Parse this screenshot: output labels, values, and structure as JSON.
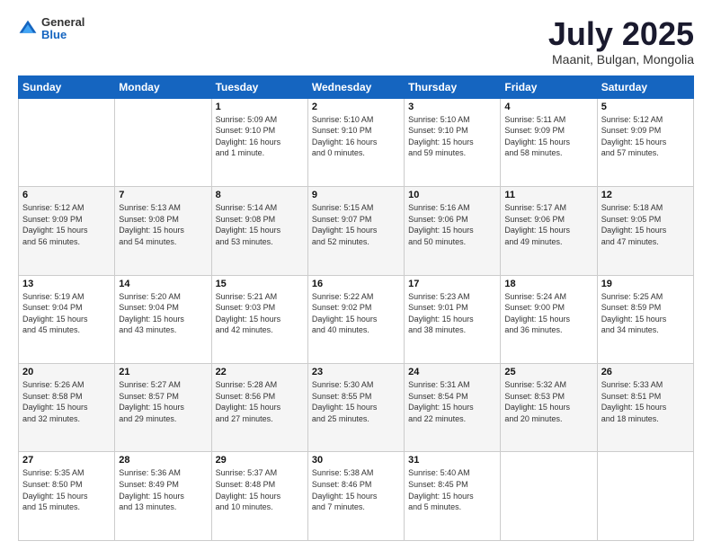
{
  "header": {
    "logo": {
      "general": "General",
      "blue": "Blue"
    },
    "title": "July 2025",
    "location": "Maanit, Bulgan, Mongolia"
  },
  "days_header": [
    "Sunday",
    "Monday",
    "Tuesday",
    "Wednesday",
    "Thursday",
    "Friday",
    "Saturday"
  ],
  "weeks": [
    [
      {
        "day": "",
        "content": ""
      },
      {
        "day": "",
        "content": ""
      },
      {
        "day": "1",
        "content": "Sunrise: 5:09 AM\nSunset: 9:10 PM\nDaylight: 16 hours\nand 1 minute."
      },
      {
        "day": "2",
        "content": "Sunrise: 5:10 AM\nSunset: 9:10 PM\nDaylight: 16 hours\nand 0 minutes."
      },
      {
        "day": "3",
        "content": "Sunrise: 5:10 AM\nSunset: 9:10 PM\nDaylight: 15 hours\nand 59 minutes."
      },
      {
        "day": "4",
        "content": "Sunrise: 5:11 AM\nSunset: 9:09 PM\nDaylight: 15 hours\nand 58 minutes."
      },
      {
        "day": "5",
        "content": "Sunrise: 5:12 AM\nSunset: 9:09 PM\nDaylight: 15 hours\nand 57 minutes."
      }
    ],
    [
      {
        "day": "6",
        "content": "Sunrise: 5:12 AM\nSunset: 9:09 PM\nDaylight: 15 hours\nand 56 minutes."
      },
      {
        "day": "7",
        "content": "Sunrise: 5:13 AM\nSunset: 9:08 PM\nDaylight: 15 hours\nand 54 minutes."
      },
      {
        "day": "8",
        "content": "Sunrise: 5:14 AM\nSunset: 9:08 PM\nDaylight: 15 hours\nand 53 minutes."
      },
      {
        "day": "9",
        "content": "Sunrise: 5:15 AM\nSunset: 9:07 PM\nDaylight: 15 hours\nand 52 minutes."
      },
      {
        "day": "10",
        "content": "Sunrise: 5:16 AM\nSunset: 9:06 PM\nDaylight: 15 hours\nand 50 minutes."
      },
      {
        "day": "11",
        "content": "Sunrise: 5:17 AM\nSunset: 9:06 PM\nDaylight: 15 hours\nand 49 minutes."
      },
      {
        "day": "12",
        "content": "Sunrise: 5:18 AM\nSunset: 9:05 PM\nDaylight: 15 hours\nand 47 minutes."
      }
    ],
    [
      {
        "day": "13",
        "content": "Sunrise: 5:19 AM\nSunset: 9:04 PM\nDaylight: 15 hours\nand 45 minutes."
      },
      {
        "day": "14",
        "content": "Sunrise: 5:20 AM\nSunset: 9:04 PM\nDaylight: 15 hours\nand 43 minutes."
      },
      {
        "day": "15",
        "content": "Sunrise: 5:21 AM\nSunset: 9:03 PM\nDaylight: 15 hours\nand 42 minutes."
      },
      {
        "day": "16",
        "content": "Sunrise: 5:22 AM\nSunset: 9:02 PM\nDaylight: 15 hours\nand 40 minutes."
      },
      {
        "day": "17",
        "content": "Sunrise: 5:23 AM\nSunset: 9:01 PM\nDaylight: 15 hours\nand 38 minutes."
      },
      {
        "day": "18",
        "content": "Sunrise: 5:24 AM\nSunset: 9:00 PM\nDaylight: 15 hours\nand 36 minutes."
      },
      {
        "day": "19",
        "content": "Sunrise: 5:25 AM\nSunset: 8:59 PM\nDaylight: 15 hours\nand 34 minutes."
      }
    ],
    [
      {
        "day": "20",
        "content": "Sunrise: 5:26 AM\nSunset: 8:58 PM\nDaylight: 15 hours\nand 32 minutes."
      },
      {
        "day": "21",
        "content": "Sunrise: 5:27 AM\nSunset: 8:57 PM\nDaylight: 15 hours\nand 29 minutes."
      },
      {
        "day": "22",
        "content": "Sunrise: 5:28 AM\nSunset: 8:56 PM\nDaylight: 15 hours\nand 27 minutes."
      },
      {
        "day": "23",
        "content": "Sunrise: 5:30 AM\nSunset: 8:55 PM\nDaylight: 15 hours\nand 25 minutes."
      },
      {
        "day": "24",
        "content": "Sunrise: 5:31 AM\nSunset: 8:54 PM\nDaylight: 15 hours\nand 22 minutes."
      },
      {
        "day": "25",
        "content": "Sunrise: 5:32 AM\nSunset: 8:53 PM\nDaylight: 15 hours\nand 20 minutes."
      },
      {
        "day": "26",
        "content": "Sunrise: 5:33 AM\nSunset: 8:51 PM\nDaylight: 15 hours\nand 18 minutes."
      }
    ],
    [
      {
        "day": "27",
        "content": "Sunrise: 5:35 AM\nSunset: 8:50 PM\nDaylight: 15 hours\nand 15 minutes."
      },
      {
        "day": "28",
        "content": "Sunrise: 5:36 AM\nSunset: 8:49 PM\nDaylight: 15 hours\nand 13 minutes."
      },
      {
        "day": "29",
        "content": "Sunrise: 5:37 AM\nSunset: 8:48 PM\nDaylight: 15 hours\nand 10 minutes."
      },
      {
        "day": "30",
        "content": "Sunrise: 5:38 AM\nSunset: 8:46 PM\nDaylight: 15 hours\nand 7 minutes."
      },
      {
        "day": "31",
        "content": "Sunrise: 5:40 AM\nSunset: 8:45 PM\nDaylight: 15 hours\nand 5 minutes."
      },
      {
        "day": "",
        "content": ""
      },
      {
        "day": "",
        "content": ""
      }
    ]
  ]
}
